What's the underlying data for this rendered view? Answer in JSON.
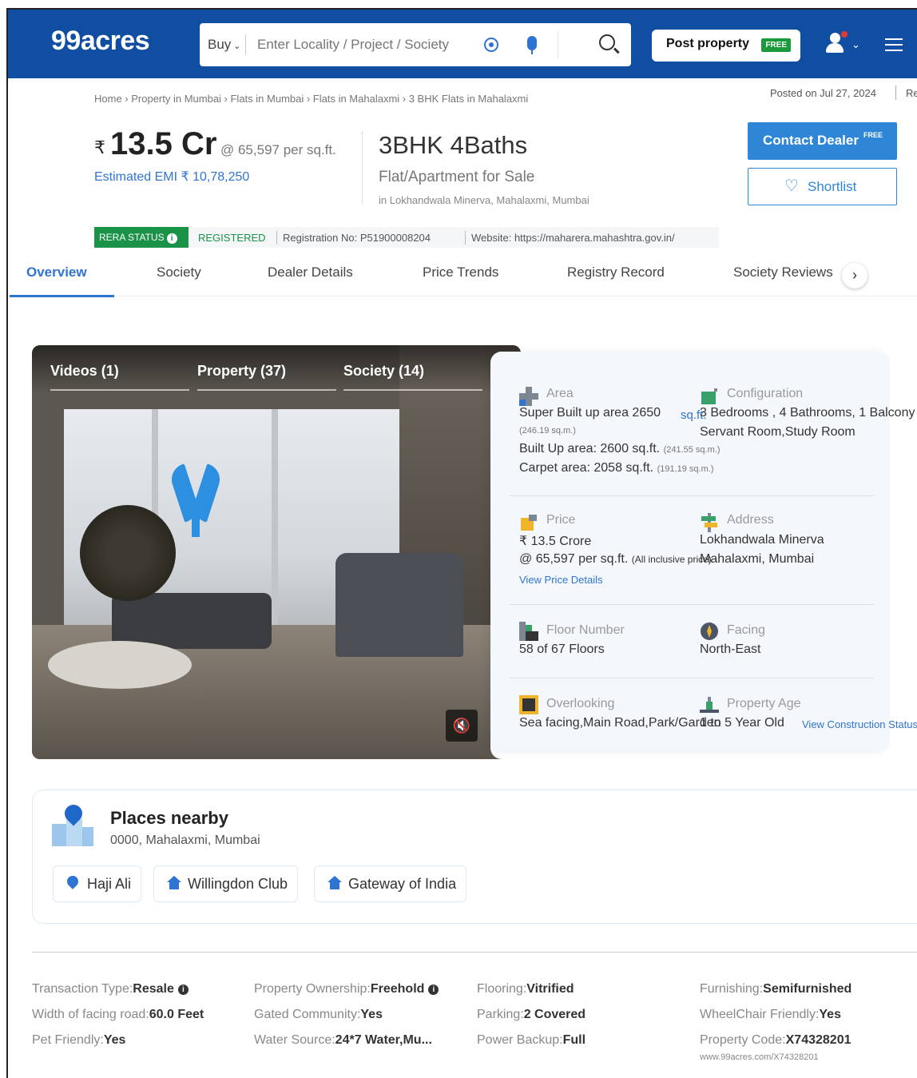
{
  "header": {
    "logo": "99acres",
    "buy_label": "Buy",
    "search_placeholder": "Enter Locality / Project / Society",
    "post_property_label": "Post property",
    "post_property_tag": "FREE"
  },
  "breadcrumb": "Home › Property in Mumbai › Flats in Mumbai › Flats in Mahalaxmi › 3 BHK Flats in Mahalaxmi",
  "posted_on": "Posted on Jul 27, 2024",
  "posted_extra": "Re",
  "price": {
    "rupee": "₹",
    "amount": "13.5 Cr",
    "per_sqft": "@ 65,597 per sq.ft.",
    "emi": "Estimated EMI ₹ 10,78,250"
  },
  "config": {
    "title": "3BHK 4Baths",
    "subtitle": "Flat/Apartment for Sale",
    "location": "in Lokhandwala Minerva, Mahalaxmi, Mumbai"
  },
  "actions": {
    "contact_label": "Contact Dealer",
    "contact_tag": "FREE",
    "shortlist_label": "Shortlist"
  },
  "rera": {
    "status_label": "RERA STATUS",
    "status_value": "REGISTERED",
    "registration": "Registration No: P51900008204",
    "website": "Website: https://maharera.mahashtra.gov.in/"
  },
  "tabs": [
    "Overview",
    "Society",
    "Dealer Details",
    "Price Trends",
    "Registry Record",
    "Society Reviews"
  ],
  "gallery": {
    "tabs": [
      "Videos (1)",
      "Property (37)",
      "Society (14)"
    ]
  },
  "details": {
    "area": {
      "label": "Area",
      "super_built": "Super Built up area 2650",
      "unit_link": "sq.ft.",
      "super_built_sqm": "(246.19 sq.m.)",
      "built_up": "Built Up area: 2600 sq.ft.",
      "built_up_sqm": "(241.55 sq.m.)",
      "carpet": "Carpet area: 2058 sq.ft.",
      "carpet_sqm": "(191.19 sq.m.)"
    },
    "configuration": {
      "label": "Configuration",
      "line1": "3 Bedrooms , 4 Bathrooms, 1 Balcony",
      "line2": "Servant Room,Study Room"
    },
    "price": {
      "label": "Price",
      "value": "₹ 13.5 Crore",
      "per_sqft": "@ 65,597 per sq.ft.",
      "inclusive": "(All inclusive price)",
      "link": "View Price Details"
    },
    "address": {
      "label": "Address",
      "line1": "Lokhandwala Minerva",
      "line2": "Mahalaxmi, Mumbai"
    },
    "floor": {
      "label": "Floor Number",
      "value": "58  of 67 Floors"
    },
    "facing": {
      "label": "Facing",
      "value": "North-East"
    },
    "overlooking": {
      "label": "Overlooking",
      "value": "Sea facing,Main Road,Park/Garden"
    },
    "age": {
      "label": "Property Age",
      "value": "1 to 5 Year Old",
      "link": "View Construction Status"
    }
  },
  "places": {
    "title": "Places nearby",
    "address": "0000, Mahalaxmi, Mumbai",
    "chips": [
      "Haji Ali",
      "Willingdon Club",
      "Gateway of India"
    ]
  },
  "features": {
    "transaction": {
      "label": "Transaction Type",
      "value": "Resale"
    },
    "width_road": {
      "label": "Width of facing road",
      "value": "60.0 Feet"
    },
    "pet": {
      "label": "Pet Friendly",
      "value": "Yes"
    },
    "ownership": {
      "label": "Property Ownership",
      "value": "Freehold"
    },
    "gated": {
      "label": "Gated Community",
      "value": "Yes"
    },
    "water": {
      "label": "Water Source",
      "value": "24*7 Water,Mu..."
    },
    "flooring": {
      "label": "Flooring",
      "value": "Vitrified"
    },
    "parking": {
      "label": "Parking",
      "value": "2 Covered"
    },
    "power": {
      "label": "Power Backup",
      "value": "Full"
    },
    "furnishing": {
      "label": "Furnishing",
      "value": "Semifurnished"
    },
    "wheelchair": {
      "label": "WheelChair Friendly",
      "value": "Yes"
    },
    "code": {
      "label": "Property Code",
      "value": "X74328201"
    },
    "url": "www.99acres.com/X74328201"
  },
  "colors": {
    "brand": "#0f4ea1",
    "accent": "#2f74d0",
    "rera_green": "#1a9349"
  }
}
